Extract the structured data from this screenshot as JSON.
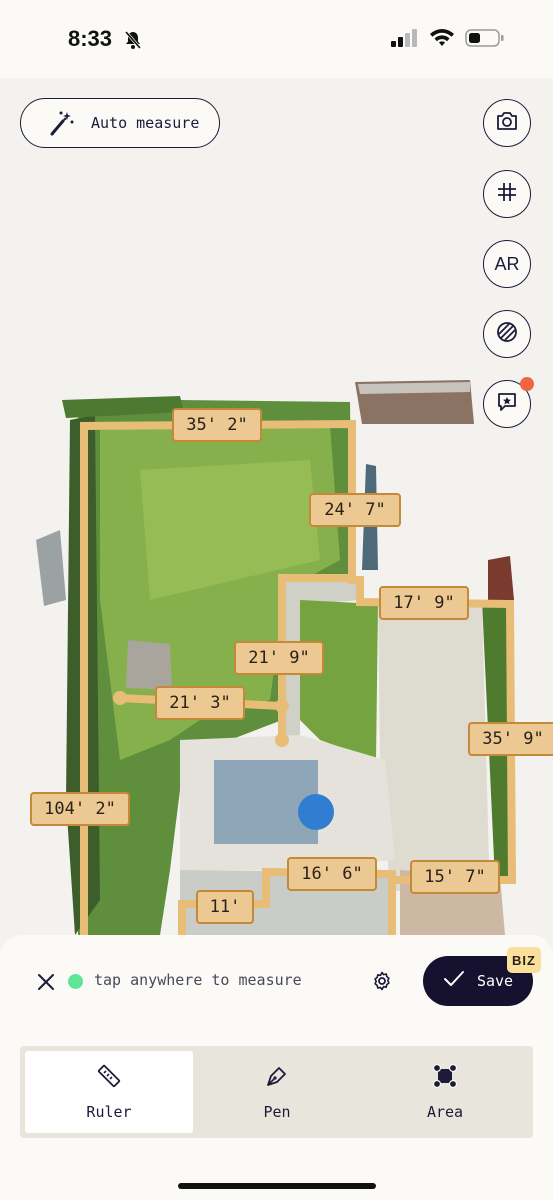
{
  "status_bar": {
    "time": "8:33",
    "icons": [
      "bell-slash-icon",
      "signal-icon",
      "wifi-icon",
      "battery-icon"
    ]
  },
  "toolbar": {
    "auto_measure_label": "Auto measure",
    "auto_measure_icon": "magic-wand-icon",
    "side_buttons": [
      "camera-icon",
      "grid-icon",
      "AR",
      "texture-icon",
      "feedback-star-icon"
    ],
    "ar_label": "AR"
  },
  "measurements": {
    "top": "35' 2\"",
    "upper_right": "24' 7\"",
    "right_mid": "17' 9\"",
    "center_vertical": "21' 9\"",
    "center_horizontal": "21' 3\"",
    "far_right": "35' 9\"",
    "left_total": "104' 2\"",
    "bottom_center": "16' 6\"",
    "bottom_right": "15' 7\"",
    "bottom_left": "11'"
  },
  "measure_bar": {
    "hint": "tap anywhere to measure",
    "save_label": "Save",
    "biz_badge": "BIZ",
    "accent": "#5ee596"
  },
  "tools": [
    {
      "label": "Ruler",
      "icon": "ruler-icon",
      "active": true
    },
    {
      "label": "Pen",
      "icon": "pen-icon",
      "active": false
    },
    {
      "label": "Area",
      "icon": "area-icon",
      "active": false
    }
  ],
  "colors": {
    "measure_line": "#e8bd78",
    "label_fill": "#ecc992",
    "label_border": "#c48a3a",
    "button_dark": "#15112e"
  }
}
